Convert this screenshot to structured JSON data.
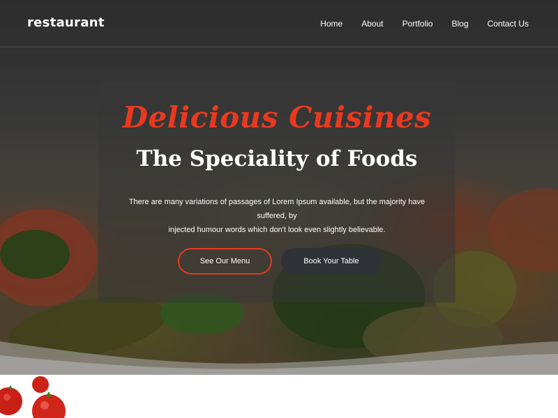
{
  "header": {
    "brand": "restaurant",
    "nav": [
      "Home",
      "About",
      "Portfolio",
      "Blog",
      "Contact Us"
    ]
  },
  "hero": {
    "script_title": "Delicious Cuisines",
    "title": "The Speciality of Foods",
    "description_line1": "There are many variations of passages of Lorem Ipsum available, but the majority have suffered, by",
    "description_line2": "injected humour words which don't look even slightly believable.",
    "primary_button": "See Our Menu",
    "secondary_button": "Book Your Table"
  },
  "colors": {
    "accent": "#e8391f",
    "dark_button": "#2f3236",
    "card_overlay": "rgba(55,55,55,0.55)"
  },
  "icons": {
    "bottom_image": "tomatoes-image"
  }
}
